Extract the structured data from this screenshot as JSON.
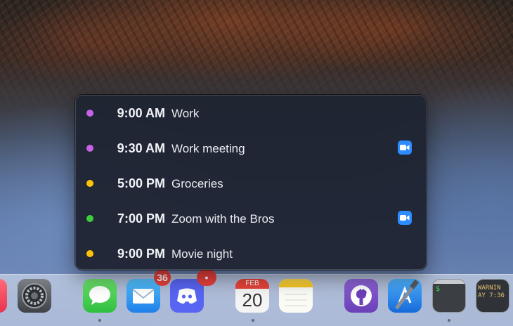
{
  "events": [
    {
      "time": "9:00 AM",
      "title": "Work",
      "color": "#c663e8",
      "zoom": false
    },
    {
      "time": "9:30 AM",
      "title": "Work meeting",
      "color": "#c663e8",
      "zoom": true
    },
    {
      "time": "5:00 PM",
      "title": "Groceries",
      "color": "#ffc20a",
      "zoom": false
    },
    {
      "time": "7:00 PM",
      "title": "Zoom with the Bros",
      "color": "#3ccf3c",
      "zoom": true
    },
    {
      "time": "9:00 PM",
      "title": "Movie night",
      "color": "#ffc20a",
      "zoom": false
    }
  ],
  "zoom_icon": "video-camera-icon",
  "dock": {
    "mail_badge": "36",
    "discord_badge": "•",
    "calendar_month": "FEB",
    "calendar_day": "20",
    "terminal_text": "$",
    "console_text_1": "WARNIN",
    "console_text_2": "AY 7:36",
    "icons": [
      "app-icon-partial",
      "system-settings-icon",
      "messages-icon",
      "mail-icon",
      "discord-icon",
      "calendar-icon",
      "notes-icon",
      "github-icon",
      "xcode-icon",
      "terminal-icon",
      "console-icon"
    ]
  }
}
